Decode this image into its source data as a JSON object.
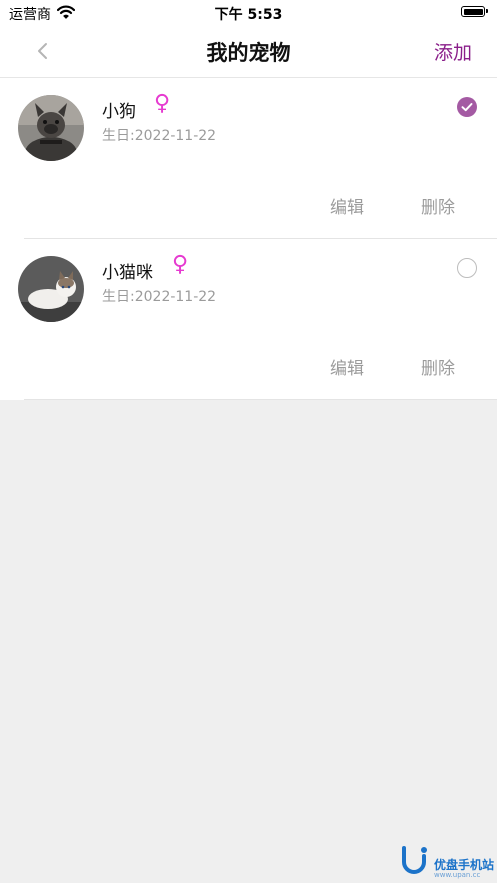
{
  "status_bar": {
    "carrier": "运营商",
    "time": "下午 5:53"
  },
  "nav": {
    "title": "我的宠物",
    "add_label": "添加"
  },
  "pets": [
    {
      "name": "小狗",
      "gender": "♀",
      "birthday": "生日:2022-11-22",
      "selected": true,
      "edit_label": "编辑",
      "delete_label": "删除",
      "avatar": "dog-photo"
    },
    {
      "name": "小猫咪",
      "gender": "♀",
      "birthday": "生日:2022-11-22",
      "selected": false,
      "edit_label": "编辑",
      "delete_label": "删除",
      "avatar": "cat-photo"
    }
  ],
  "watermark": {
    "text": "优盘手机站",
    "sub": "www.upan.cc"
  },
  "colors": {
    "accent": "#8a1e8a",
    "check_selected": "#a45aa3",
    "gender": "#e63ad0",
    "muted": "#9b9b9b",
    "background": "#efefef"
  }
}
